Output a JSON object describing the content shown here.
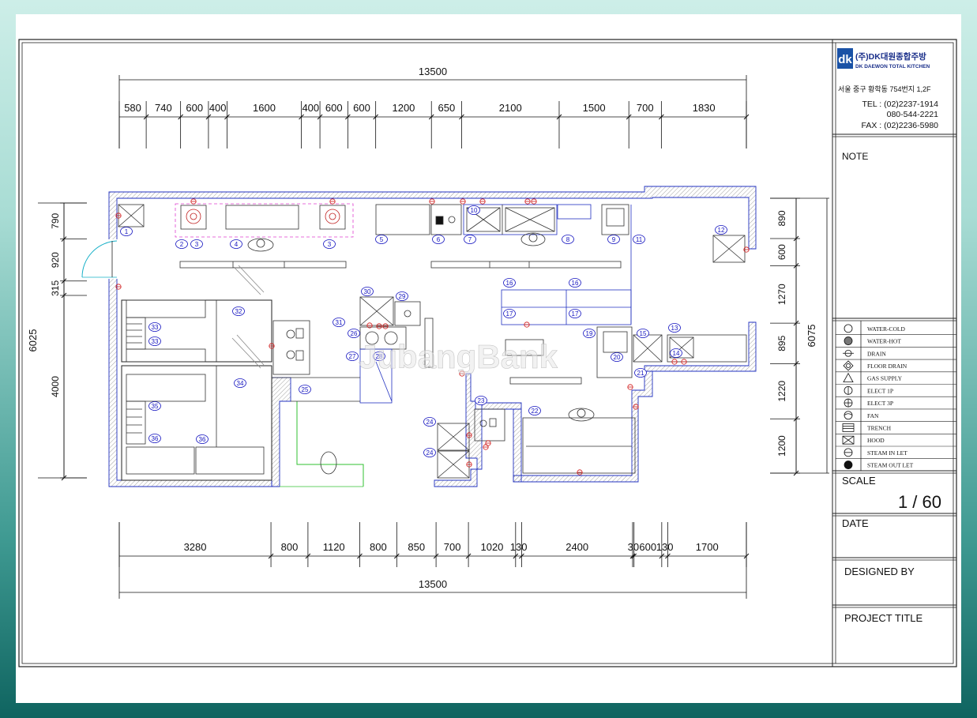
{
  "company": {
    "logo_text": "dk",
    "name_ko": "(주)DK대원종합주방",
    "name_en": "DK DAEWON TOTAL KITCHEN",
    "address": "서울 중구 황학동 754번지 1,2F",
    "tel_label": "TEL : (02)2237-1914",
    "tel2": "080-544-2221",
    "fax_label": "FAX : (02)2236-5980"
  },
  "title_block": {
    "note_label": "NOTE",
    "scale_label": "SCALE",
    "scale_value": "1 / 60",
    "date_label": "DATE",
    "designed_by_label": "DESIGNED BY",
    "project_title_label": "PROJECT TITLE"
  },
  "legend": [
    {
      "symbol": "water-cold-icon",
      "label": "WATER-COLD"
    },
    {
      "symbol": "water-hot-icon",
      "label": "WATER-HOT"
    },
    {
      "symbol": "drain-icon",
      "label": "DRAIN"
    },
    {
      "symbol": "floor-drain-icon",
      "label": "FLOOR DRAIN"
    },
    {
      "symbol": "gas-supply-icon",
      "label": "GAS SUPPLY"
    },
    {
      "symbol": "elect-1p-icon",
      "label": "ELECT 1P"
    },
    {
      "symbol": "elect-3p-icon",
      "label": "ELECT 3P"
    },
    {
      "symbol": "fan-icon",
      "label": "FAN"
    },
    {
      "symbol": "trench-icon",
      "label": "TRENCH"
    },
    {
      "symbol": "hood-icon",
      "label": "HOOD"
    },
    {
      "symbol": "steam-in-let-icon",
      "label": "STEAM IN LET"
    },
    {
      "symbol": "steam-out-let-icon",
      "label": "STEAM OUT LET"
    }
  ],
  "dimensions": {
    "top_total": "13500",
    "top_segments": [
      "580",
      "740",
      "600",
      "400",
      "1600",
      "400",
      "600",
      "600",
      "1200",
      "650",
      "2100",
      "1500",
      "700",
      "1830"
    ],
    "bottom_total": "13500",
    "bottom_segments": [
      "3280",
      "800",
      "1120",
      "800",
      "850",
      "700",
      "1020",
      "130",
      "2400",
      "30",
      "600",
      "130",
      "1700"
    ],
    "left_total": "6025",
    "left_segments": [
      "790",
      "920",
      "315",
      "4000"
    ],
    "right_total": "6075",
    "right_segments": [
      "890",
      "600",
      "1270",
      "895",
      "1220",
      "1200"
    ]
  },
  "equipment_numbers": [
    "1",
    "2",
    "3",
    "4",
    "3",
    "5",
    "6",
    "7",
    "10",
    "8",
    "9",
    "11",
    "12",
    "16",
    "16",
    "17",
    "17",
    "15",
    "13",
    "14",
    "19",
    "20",
    "21",
    "30",
    "29",
    "31",
    "32",
    "33",
    "33",
    "34",
    "35",
    "36",
    "36",
    "25",
    "26",
    "27",
    "28",
    "22",
    "23",
    "24",
    "24"
  ],
  "watermark": "JubangBank"
}
